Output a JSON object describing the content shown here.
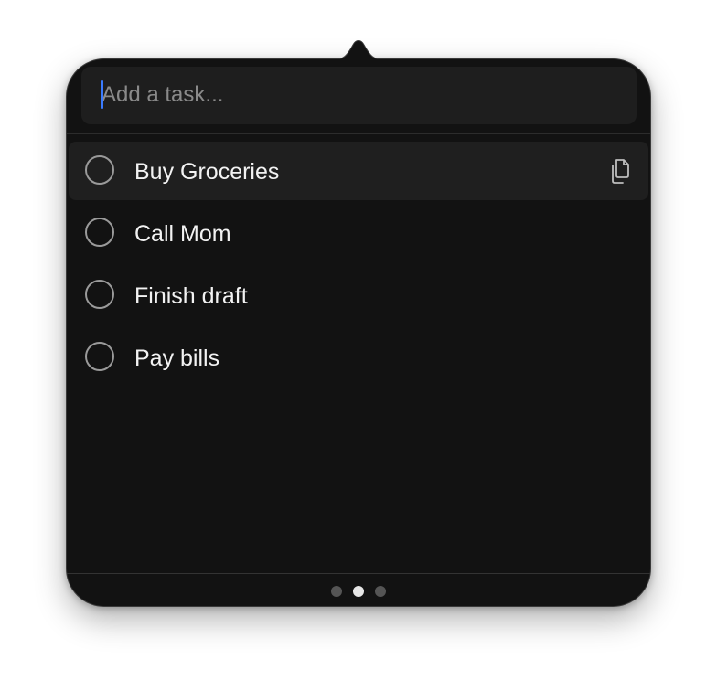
{
  "input": {
    "placeholder": "Add a task...",
    "value": ""
  },
  "tasks": [
    {
      "label": "Buy Groceries",
      "done": false,
      "hovered": true
    },
    {
      "label": "Call Mom",
      "done": false,
      "hovered": false
    },
    {
      "label": "Finish draft",
      "done": false,
      "hovered": false
    },
    {
      "label": "Pay bills",
      "done": false,
      "hovered": false
    }
  ],
  "pagination": {
    "pages": 3,
    "current": 2
  },
  "icons": {
    "row_action": "copy-icon",
    "status": "circle-icon"
  },
  "colors": {
    "background": "#121212",
    "input_background": "#1e1e1e",
    "row_hover": "#1f1f1f",
    "caret": "#3a7bff",
    "text": "#f2f2f2",
    "placeholder": "#8a8a8a"
  }
}
